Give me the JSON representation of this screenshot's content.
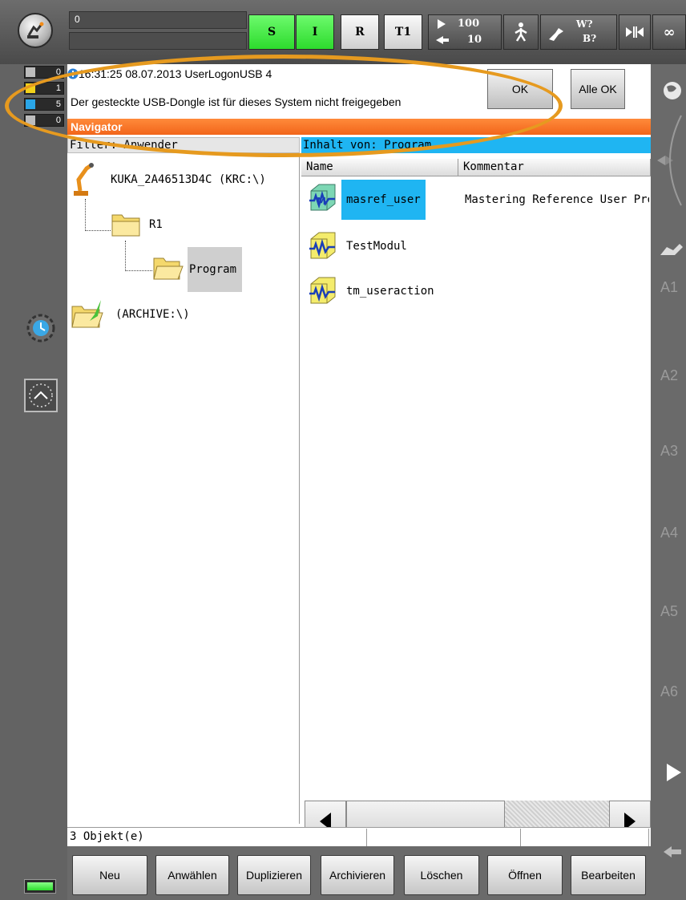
{
  "topbar": {
    "message_counter": "0",
    "message_line2": "",
    "submit_status": "S",
    "drives_status": "I",
    "robot_interpreter": "R",
    "operating_mode": "T1",
    "override_program": "100",
    "override_jog": "10",
    "tool_label_w": "W?",
    "tool_label_b": "B?",
    "increment": "∞"
  },
  "message_counters": [
    {
      "type": "acknowledge",
      "count": "0"
    },
    {
      "type": "state",
      "count": "1"
    },
    {
      "type": "info",
      "count": "5"
    },
    {
      "type": "dialog",
      "count": "0"
    }
  ],
  "message": {
    "header": "16:31:25 08.07.2013 UserLogonUSB 4",
    "text": "Der gesteckte USB-Dongle ist für dieses System nicht freigegeben",
    "ok_label": "OK",
    "all_ok_label": "Alle OK"
  },
  "navigator": {
    "title": "Navigator",
    "filter": "Filter: Anwender",
    "content_of": "Inhalt von: Program",
    "tree": {
      "robot": "KUKA_2A46513D4C (KRC:\\)",
      "r1": "R1",
      "program": "Program",
      "archive": "(ARCHIVE:\\)"
    },
    "columns": [
      "Name",
      "Kommentar"
    ],
    "rows": [
      {
        "name": "masref_user",
        "comment": "Mastering Reference User Pro"
      },
      {
        "name": "TestModul",
        "comment": ""
      },
      {
        "name": "tm_useraction",
        "comment": ""
      }
    ]
  },
  "status": {
    "object_count": "3 Objekt(e)",
    "cell2": "",
    "cell3": ""
  },
  "axes": [
    "A1",
    "A2",
    "A3",
    "A4",
    "A5",
    "A6"
  ],
  "buttons": {
    "neu": "Neu",
    "anwaehlen": "Anwählen",
    "duplizieren": "Duplizieren",
    "archivieren": "Archivieren",
    "loeschen": "Löschen",
    "oeffnen": "Öffnen",
    "bearbeiten": "Bearbeiten"
  },
  "colors": {
    "selection_blue": "#1fb5f2",
    "navigator_orange": "#f2651a",
    "status_green": "#2ddb2d",
    "highlight_ring": "#e69a1f"
  }
}
